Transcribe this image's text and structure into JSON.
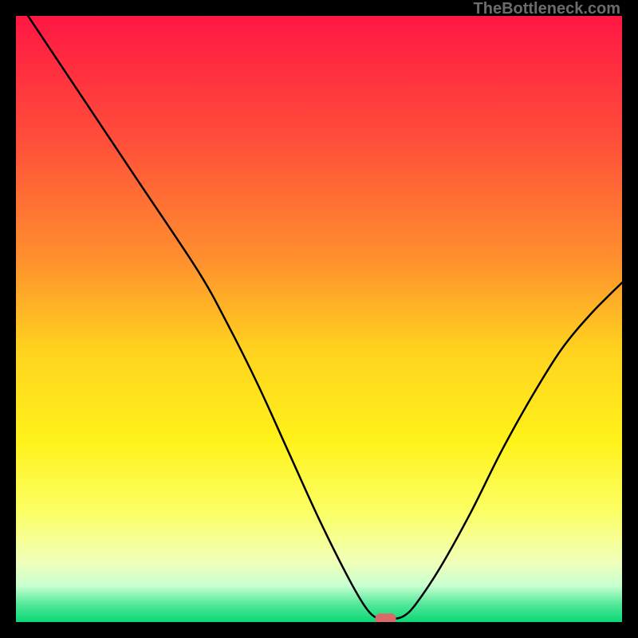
{
  "watermark": "TheBottleneck.com",
  "chart_data": {
    "type": "line",
    "title": "",
    "xlabel": "",
    "ylabel": "",
    "xlim": [
      0,
      100
    ],
    "ylim": [
      0,
      100
    ],
    "series": [
      {
        "name": "bottleneck-curve",
        "x": [
          2,
          10,
          20,
          30,
          35,
          40,
          45,
          50,
          55,
          58,
          60,
          62,
          64,
          66,
          70,
          75,
          80,
          85,
          90,
          95,
          100
        ],
        "values": [
          100,
          88,
          73,
          58,
          49,
          39,
          28,
          17,
          7,
          2,
          0.5,
          0.5,
          1,
          3,
          9,
          18,
          28,
          37,
          45,
          51,
          56
        ]
      }
    ],
    "marker": {
      "x": 61,
      "y": 0.5
    },
    "gradient_stops": [
      {
        "offset": 0,
        "color": "#ff1744"
      },
      {
        "offset": 0.2,
        "color": "#ff4d3a"
      },
      {
        "offset": 0.4,
        "color": "#ff8f2e"
      },
      {
        "offset": 0.55,
        "color": "#ffd21f"
      },
      {
        "offset": 0.7,
        "color": "#fff21a"
      },
      {
        "offset": 0.82,
        "color": "#fbff66"
      },
      {
        "offset": 0.9,
        "color": "#f1ffb8"
      },
      {
        "offset": 0.94,
        "color": "#c8ffd0"
      },
      {
        "offset": 0.97,
        "color": "#55e89a"
      },
      {
        "offset": 1.0,
        "color": "#0bd875"
      }
    ]
  }
}
